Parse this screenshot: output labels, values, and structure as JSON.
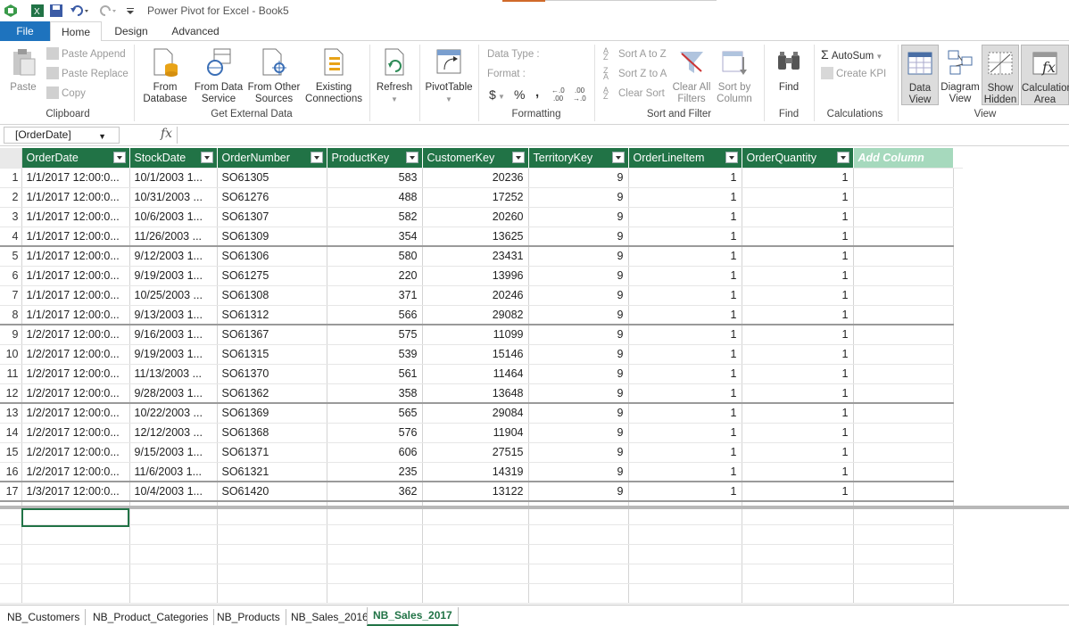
{
  "app": {
    "title": "Power Pivot for Excel - Book5"
  },
  "tabs": [
    "File",
    "Home",
    "Design",
    "Advanced"
  ],
  "ribbon": {
    "clipboard": {
      "label": "Clipboard",
      "paste": "Paste",
      "paste_append": "Paste Append",
      "paste_replace": "Paste Replace",
      "copy": "Copy"
    },
    "external": {
      "label": "Get External Data",
      "from_db_1": "From",
      "from_db_2": "Database",
      "from_ds_1": "From Data",
      "from_ds_2": "Service",
      "from_other_1": "From Other",
      "from_other_2": "Sources",
      "existing_1": "Existing",
      "existing_2": "Connections"
    },
    "refresh": {
      "label": "Refresh"
    },
    "pivot": {
      "label": "PivotTable"
    },
    "formatting": {
      "label": "Formatting",
      "data_type": "Data Type :",
      "format": "Format :",
      "currency": "$",
      "percent": "%",
      "comma": "͗",
      "inc": ".0 .00",
      "dec": ".00 .0"
    },
    "sortfilter": {
      "label": "Sort and Filter",
      "sort_az": "Sort A to Z",
      "sort_za": "Sort Z to A",
      "clear_sort": "Clear Sort",
      "clear_all_1": "Clear All",
      "clear_all_2": "Filters",
      "sort_col_1": "Sort by",
      "sort_col_2": "Column"
    },
    "find": {
      "label": "Find",
      "btn": "Find"
    },
    "calc": {
      "label": "Calculations",
      "autosum": "AutoSum",
      "create_kpi": "Create KPI"
    },
    "view": {
      "label": "View",
      "data_1": "Data",
      "data_2": "View",
      "diagram_1": "Diagram",
      "diagram_2": "View",
      "hidden_1": "Show",
      "hidden_2": "Hidden",
      "calc_1": "Calculation",
      "calc_2": "Area"
    }
  },
  "formula": {
    "name_box": "[OrderDate]",
    "fx": "fx",
    "value": ""
  },
  "grid": {
    "columns": [
      "OrderDate",
      "StockDate",
      "OrderNumber",
      "ProductKey",
      "CustomerKey",
      "TerritoryKey",
      "OrderLineItem",
      "OrderQuantity",
      "Add Column"
    ],
    "rows": [
      [
        "1/1/2017 12:00:0...",
        "10/1/2003 1...",
        "SO61305",
        "583",
        "20236",
        "9",
        "1",
        "1"
      ],
      [
        "1/1/2017 12:00:0...",
        "10/31/2003 ...",
        "SO61276",
        "488",
        "17252",
        "9",
        "1",
        "1"
      ],
      [
        "1/1/2017 12:00:0...",
        "10/6/2003 1...",
        "SO61307",
        "582",
        "20260",
        "9",
        "1",
        "1"
      ],
      [
        "1/1/2017 12:00:0...",
        "11/26/2003 ...",
        "SO61309",
        "354",
        "13625",
        "9",
        "1",
        "1"
      ],
      [
        "1/1/2017 12:00:0...",
        "9/12/2003 1...",
        "SO61306",
        "580",
        "23431",
        "9",
        "1",
        "1"
      ],
      [
        "1/1/2017 12:00:0...",
        "9/19/2003 1...",
        "SO61275",
        "220",
        "13996",
        "9",
        "1",
        "1"
      ],
      [
        "1/1/2017 12:00:0...",
        "10/25/2003 ...",
        "SO61308",
        "371",
        "20246",
        "9",
        "1",
        "1"
      ],
      [
        "1/1/2017 12:00:0...",
        "9/13/2003 1...",
        "SO61312",
        "566",
        "29082",
        "9",
        "1",
        "1"
      ],
      [
        "1/2/2017 12:00:0...",
        "9/16/2003 1...",
        "SO61367",
        "575",
        "11099",
        "9",
        "1",
        "1"
      ],
      [
        "1/2/2017 12:00:0...",
        "9/19/2003 1...",
        "SO61315",
        "539",
        "15146",
        "9",
        "1",
        "1"
      ],
      [
        "1/2/2017 12:00:0...",
        "11/13/2003 ...",
        "SO61370",
        "561",
        "11464",
        "9",
        "1",
        "1"
      ],
      [
        "1/2/2017 12:00:0...",
        "9/28/2003 1...",
        "SO61362",
        "358",
        "13648",
        "9",
        "1",
        "1"
      ],
      [
        "1/2/2017 12:00:0...",
        "10/22/2003 ...",
        "SO61369",
        "565",
        "29084",
        "9",
        "1",
        "1"
      ],
      [
        "1/2/2017 12:00:0...",
        "12/12/2003 ...",
        "SO61368",
        "576",
        "11904",
        "9",
        "1",
        "1"
      ],
      [
        "1/2/2017 12:00:0...",
        "9/15/2003 1...",
        "SO61371",
        "606",
        "27515",
        "9",
        "1",
        "1"
      ],
      [
        "1/2/2017 12:00:0...",
        "11/6/2003 1...",
        "SO61321",
        "235",
        "14319",
        "9",
        "1",
        "1"
      ],
      [
        "1/3/2017 12:00:0...",
        "10/4/2003 1...",
        "SO61420",
        "362",
        "13122",
        "9",
        "1",
        "1"
      ]
    ]
  },
  "sheets": [
    "NB_Customers",
    "NB_Product_Categories",
    "NB_Products",
    "NB_Sales_2016",
    "NB_Sales_2017"
  ],
  "active_sheet": "NB_Sales_2017",
  "colors": {
    "accent": "#217346",
    "file_tab": "#1e73be",
    "add_column": "#a6d9bd"
  }
}
